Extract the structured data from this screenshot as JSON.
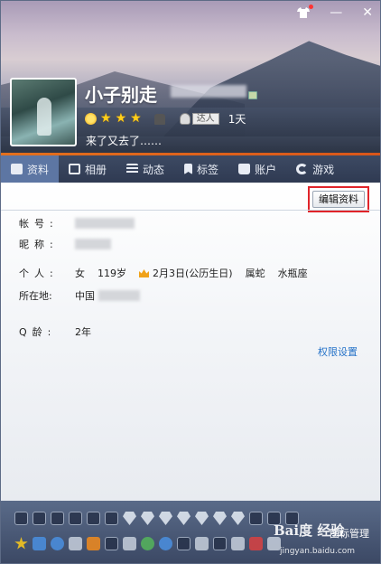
{
  "header": {
    "nickname": "小子别走",
    "days": "1天",
    "expert_tag": "达人",
    "signature": "来了又去了……",
    "level_stars": 3
  },
  "tabs": [
    {
      "label": "资料",
      "icon": "profile-card-icon"
    },
    {
      "label": "相册",
      "icon": "photo-icon"
    },
    {
      "label": "动态",
      "icon": "list-icon"
    },
    {
      "label": "标签",
      "icon": "bookmark-icon"
    },
    {
      "label": "账户",
      "icon": "wallet-icon"
    },
    {
      "label": "游戏",
      "icon": "game-icon"
    }
  ],
  "profile": {
    "edit_button": "编辑资料",
    "account_label": "帐号:",
    "nick_label": "昵称:",
    "personal_label": "个人:",
    "gender": "女",
    "age": "119岁",
    "birthday": "2月3日(公历生日)",
    "zodiac": "属蛇",
    "constellation": "水瓶座",
    "location_label": "所在地:",
    "location": "中国",
    "qage_label": "Q龄:",
    "qage": "2年",
    "permission_link": "权限设置"
  },
  "footer": {
    "manage_label": "图标管理"
  },
  "watermark": {
    "brand": "Bai度 经验",
    "url": "jingyan.baidu.com"
  },
  "colors": {
    "accent_orange": "#e3701d",
    "tab_bar": "#2f3a52",
    "tab_active": "#5d76a3",
    "link_blue": "#2673c8",
    "highlight_red": "#e0242a"
  }
}
